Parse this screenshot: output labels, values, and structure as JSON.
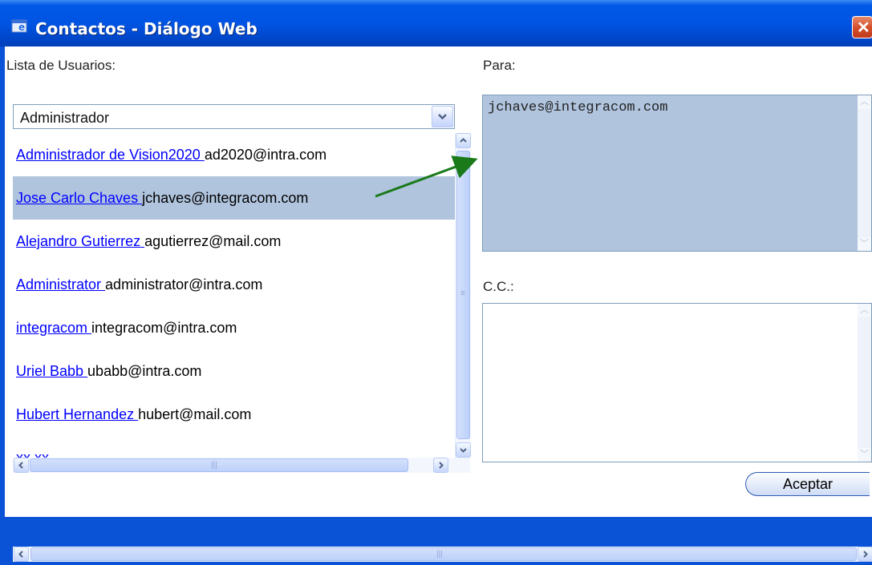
{
  "window": {
    "title": "Contactos - Diálogo Web"
  },
  "left": {
    "label": "Lista de Usuarios:",
    "group_select": "Administrador",
    "users": [
      {
        "name": "Administrador de Vision2020 ",
        "email": "ad2020@intra.com"
      },
      {
        "name": "Jose Carlo Chaves ",
        "email": "jchaves@integracom.com"
      },
      {
        "name": "Alejandro Gutierrez ",
        "email": "agutierrez@mail.com"
      },
      {
        "name": "Administrator ",
        "email": "administrator@intra.com"
      },
      {
        "name": "integracom ",
        "email": "integracom@intra.com"
      },
      {
        "name": "Uriel Babb ",
        "email": "ubabb@intra.com"
      },
      {
        "name": "Hubert Hernandez ",
        "email": "hubert@mail.com"
      },
      {
        "name": "xx xx",
        "email": ""
      }
    ],
    "selected_index": 1
  },
  "right": {
    "to_label": "Para:",
    "to_value": "jchaves@integracom.com",
    "cc_label": "C.C.:",
    "cc_value": "",
    "accept_label": "Aceptar"
  },
  "colors": {
    "titlebar": "#0054e3",
    "selection": "#b0c4de",
    "link": "#0000ff",
    "annotation_arrow": "#1a7a1a"
  },
  "icons": {
    "title": "ie-window-icon",
    "close": "close-icon"
  }
}
